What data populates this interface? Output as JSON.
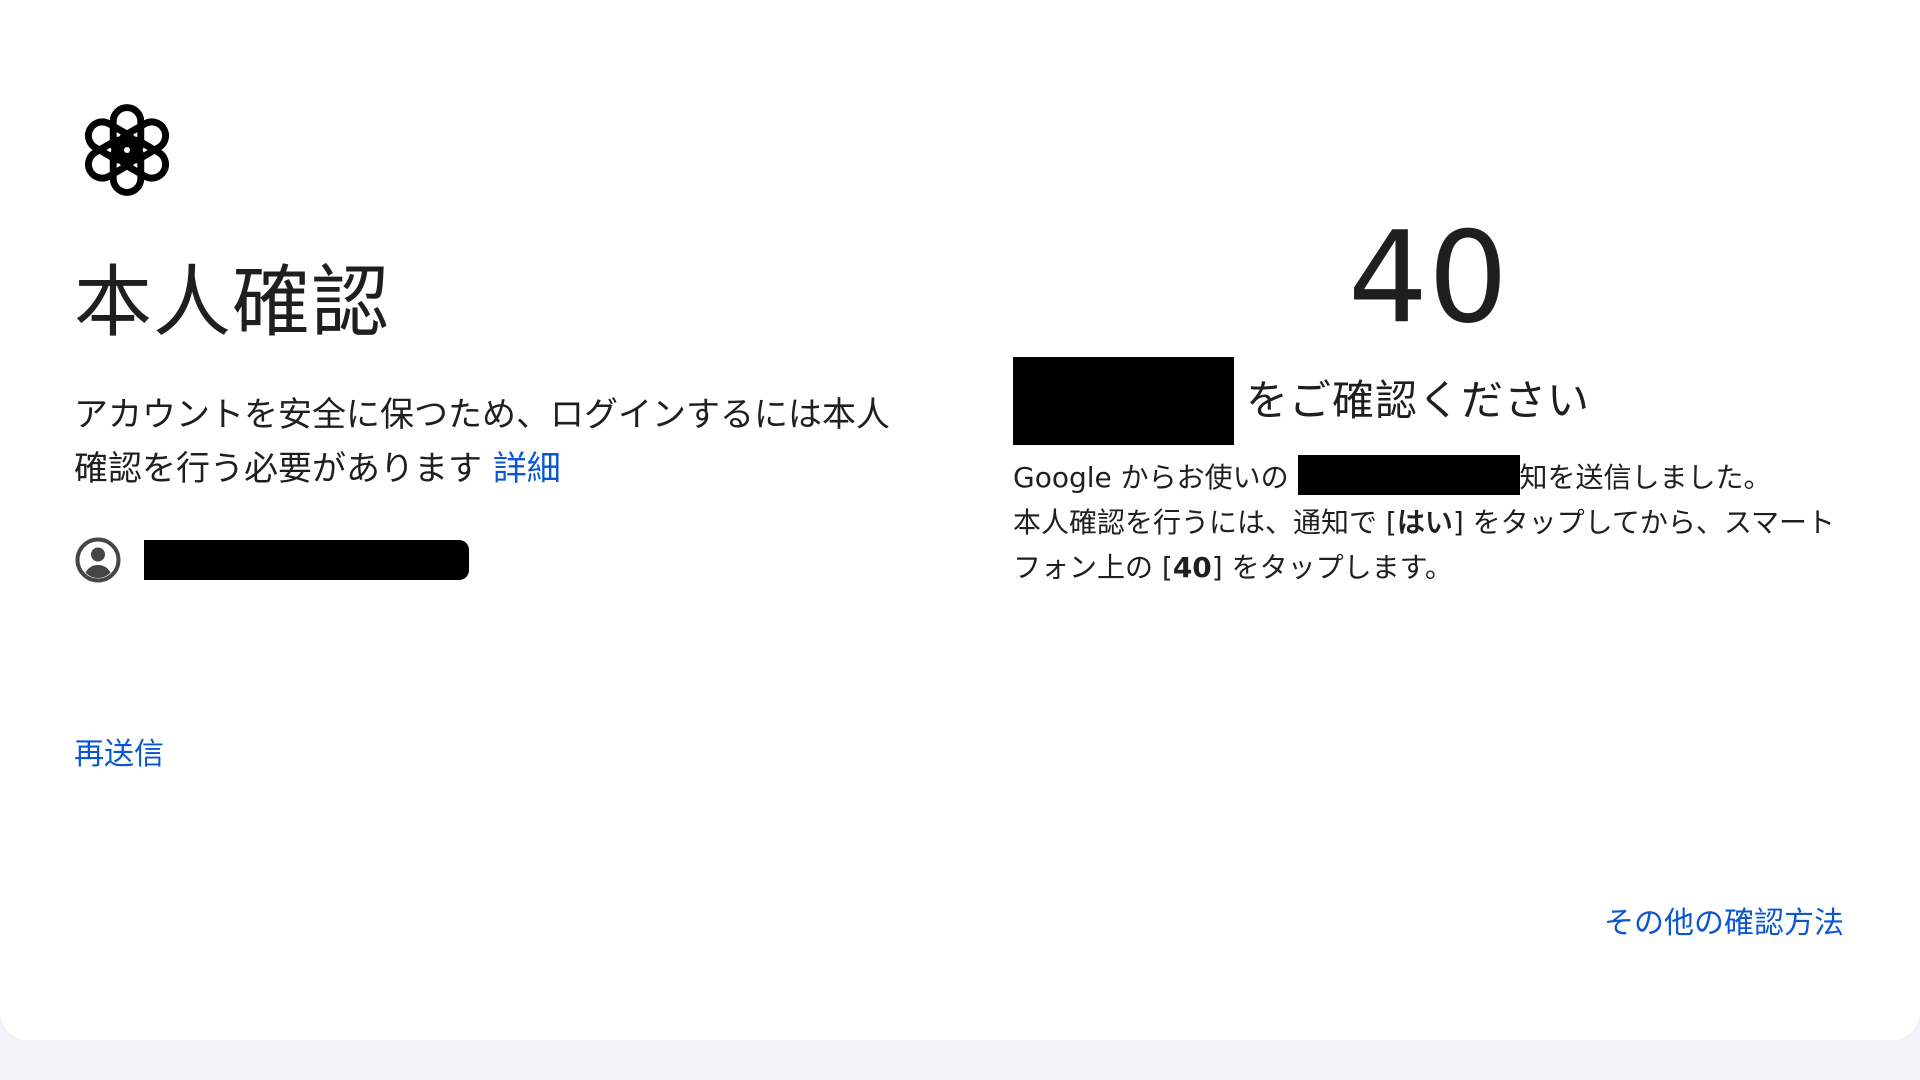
{
  "logo": {
    "icon": "openai-logo-icon"
  },
  "page": {
    "title": "本人確認",
    "description": "アカウントを安全に保つため、ログインするには本人確認を行う必要があります",
    "details_link": "詳細"
  },
  "account": {
    "icon": "account-circle-icon"
  },
  "resend_label": "再送信",
  "verification": {
    "number": "40",
    "heading_suffix": "をご確認ください",
    "line1_prefix": "Google からお使いの",
    "line1_suffix": "知を送信しました。",
    "line2_prefix": "本人確認を行うには、通知で [",
    "line2_bold": "はい",
    "line2_suffix": "] をタップしてから、スマートフォン上の [",
    "line3_bold": "40",
    "line3_suffix": "] をタップします。"
  },
  "other_methods_label": "その他の確認方法"
}
